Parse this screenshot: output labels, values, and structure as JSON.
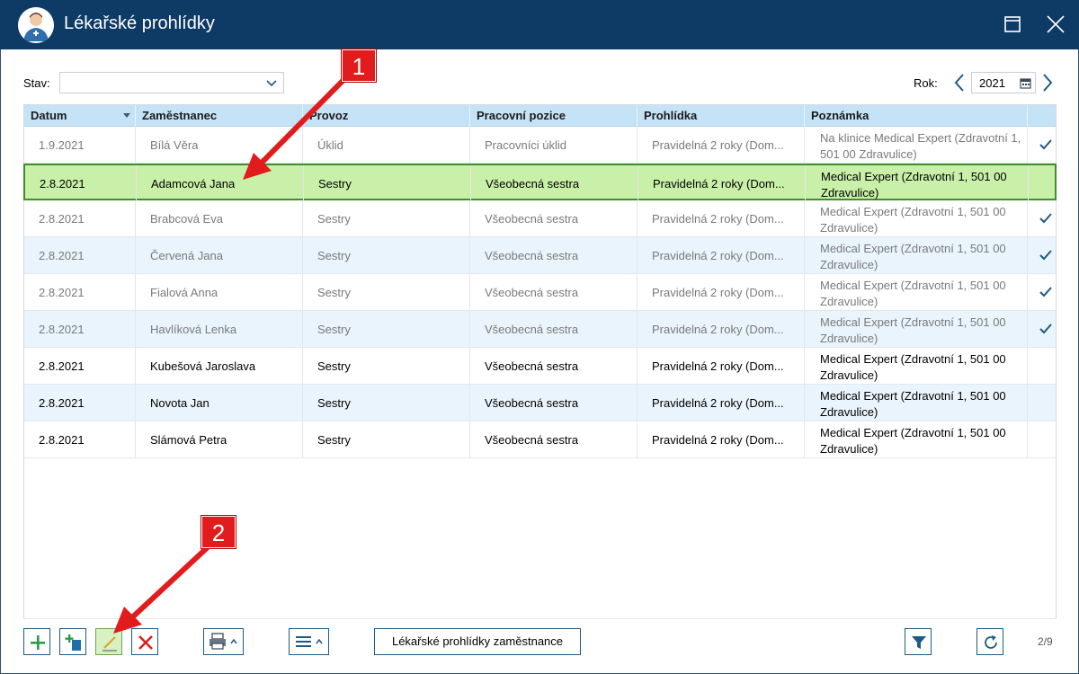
{
  "window": {
    "title": "Lékařské prohlídky"
  },
  "filters": {
    "stav_label": "Stav:",
    "stav_value": "",
    "rok_label": "Rok:",
    "rok_value": "2021"
  },
  "table": {
    "columns": [
      "Datum",
      "Zaměstnanec",
      "Provoz",
      "Pracovní pozice",
      "Prohlídka",
      "Poznámka"
    ],
    "rows": [
      {
        "datum": "1.9.2021",
        "zamestnanec": "Bílá Věra",
        "provoz": "Úklid",
        "pozice": "Pracovníci úklid",
        "prohlidka": "Pravidelná 2 roky (Dom...",
        "poznamka": "Na klinice Medical Expert (Zdravotní 1, 501 00 Zdravulice)",
        "checked": true,
        "dim": true,
        "selected": false
      },
      {
        "datum": "2.8.2021",
        "zamestnanec": "Adamcová Jana",
        "provoz": "Sestry",
        "pozice": "Všeobecná sestra",
        "prohlidka": "Pravidelná 2 roky (Dom...",
        "poznamka": "Medical Expert (Zdravotní 1, 501 00 Zdravulice)",
        "checked": false,
        "dim": false,
        "selected": true
      },
      {
        "datum": "2.8.2021",
        "zamestnanec": "Brabcová Eva",
        "provoz": "Sestry",
        "pozice": "Všeobecná sestra",
        "prohlidka": "Pravidelná 2 roky (Dom...",
        "poznamka": "Medical Expert (Zdravotní 1, 501 00 Zdravulice)",
        "checked": true,
        "dim": true,
        "selected": false
      },
      {
        "datum": "2.8.2021",
        "zamestnanec": "Červená Jana",
        "provoz": "Sestry",
        "pozice": "Všeobecná sestra",
        "prohlidka": "Pravidelná 2 roky (Dom...",
        "poznamka": "Medical Expert (Zdravotní 1, 501 00 Zdravulice)",
        "checked": true,
        "dim": true,
        "selected": false
      },
      {
        "datum": "2.8.2021",
        "zamestnanec": "Fialová Anna",
        "provoz": "Sestry",
        "pozice": "Všeobecná sestra",
        "prohlidka": "Pravidelná 2 roky (Dom...",
        "poznamka": "Medical Expert (Zdravotní 1, 501 00 Zdravulice)",
        "checked": true,
        "dim": true,
        "selected": false
      },
      {
        "datum": "2.8.2021",
        "zamestnanec": "Havlíková Lenka",
        "provoz": "Sestry",
        "pozice": "Všeobecná sestra",
        "prohlidka": "Pravidelná 2 roky (Dom...",
        "poznamka": "Medical Expert (Zdravotní 1, 501 00 Zdravulice)",
        "checked": true,
        "dim": true,
        "selected": false
      },
      {
        "datum": "2.8.2021",
        "zamestnanec": "Kubešová Jaroslava",
        "provoz": "Sestry",
        "pozice": "Všeobecná sestra",
        "prohlidka": "Pravidelná 2 roky (Dom...",
        "poznamka": "Medical Expert (Zdravotní 1, 501 00 Zdravulice)",
        "checked": false,
        "dim": false,
        "selected": false
      },
      {
        "datum": "2.8.2021",
        "zamestnanec": "Novota Jan",
        "provoz": "Sestry",
        "pozice": "Všeobecná sestra",
        "prohlidka": "Pravidelná 2 roky (Dom...",
        "poznamka": "Medical Expert (Zdravotní 1, 501 00 Zdravulice)",
        "checked": false,
        "dim": false,
        "selected": false
      },
      {
        "datum": "2.8.2021",
        "zamestnanec": "Slámová Petra",
        "provoz": "Sestry",
        "pozice": "Všeobecná sestra",
        "prohlidka": "Pravidelná 2 roky (Dom...",
        "poznamka": "Medical Expert (Zdravotní 1, 501 00 Zdravulice)",
        "checked": false,
        "dim": false,
        "selected": false
      }
    ]
  },
  "toolbar": {
    "employee_exams_label": "Lékařské prohlídky zaměstnance",
    "page_counter": "2/9"
  },
  "annotations": {
    "callout_1": "1",
    "callout_2": "2"
  },
  "colors": {
    "titlebar": "#0e3a66",
    "header": "#c5e3f6",
    "selected_row": "#c9f0a8",
    "callout": "#e21c1c"
  }
}
